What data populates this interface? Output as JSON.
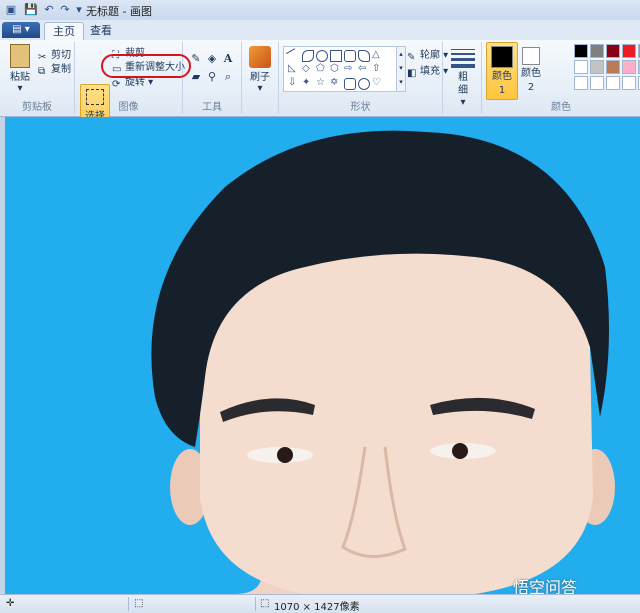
{
  "window": {
    "title": "无标题 - 画图"
  },
  "tabs": [
    {
      "label": "主页",
      "active": true
    },
    {
      "label": "查看",
      "active": false
    }
  ],
  "ribbon": {
    "clipboard": {
      "paste_label": "粘贴",
      "cut_label": "剪切",
      "copy_label": "复制",
      "group_label": "剪贴板"
    },
    "image": {
      "select_label": "选择",
      "crop_label": "裁剪",
      "resize_label": "重新调整大小",
      "rotate_label": "旋转",
      "group_label": "图像"
    },
    "tools": {
      "group_label": "工具",
      "text_glyph": "A"
    },
    "brushes": {
      "label": "刷子"
    },
    "shapes": {
      "outline_label": "轮廓",
      "fill_label": "填充",
      "group_label": "形状"
    },
    "size": {
      "label": "粗细"
    },
    "colors": {
      "color1_label": "颜色 1",
      "color2_label": "颜色 2",
      "group_label": "颜色",
      "palette": [
        "#000000",
        "#7f7f7f",
        "#880015",
        "#ed1c24",
        "#ff7f27",
        "#ffffff",
        "#c3c3c3",
        "#b97a57",
        "#ffaec9",
        "#ffc90e",
        "#ffffff",
        "#ffffff",
        "#ffffff",
        "#ffffff",
        "#ffffff"
      ]
    }
  },
  "status": {
    "dimensions": "1070 × 1427像素"
  },
  "watermark": "悟空问答",
  "colors": {
    "sky": "#22adee",
    "highlight": "#d8141b"
  }
}
